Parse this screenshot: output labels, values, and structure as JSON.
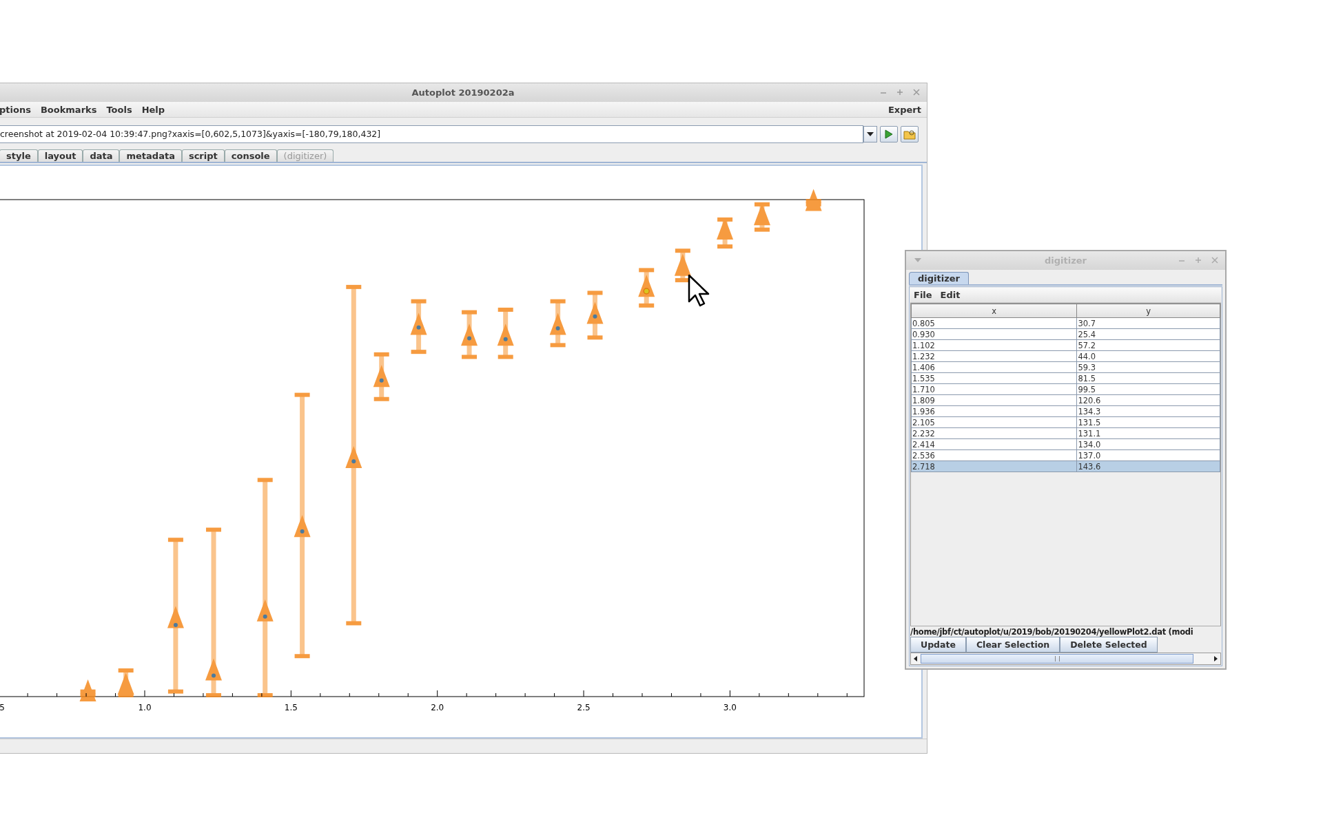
{
  "main_window": {
    "title": "Autoplot 20190202a",
    "menu": [
      "ptions",
      "Bookmarks",
      "Tools",
      "Help"
    ],
    "mode": "Expert",
    "url": "creenshot at 2019-02-04 10:39:47.png?xaxis=[0,602,5,1073]&yaxis=[-180,79,180,432]",
    "tabs": [
      {
        "label": "style",
        "selected": false,
        "disabled": false
      },
      {
        "label": "layout",
        "selected": false,
        "disabled": false
      },
      {
        "label": "data",
        "selected": false,
        "disabled": false
      },
      {
        "label": "metadata",
        "selected": false,
        "disabled": false
      },
      {
        "label": "script",
        "selected": false,
        "disabled": false
      },
      {
        "label": "console",
        "selected": false,
        "disabled": false
      },
      {
        "label": "(digitizer)",
        "selected": false,
        "disabled": true
      }
    ],
    "plot": {
      "xtick_labels": [
        "5",
        "1.0",
        "1.5",
        "2.0",
        "2.5",
        "3.0"
      ]
    }
  },
  "digitizer": {
    "title": "digitizer",
    "active": false,
    "tabs": [
      {
        "label": "digitizer",
        "selected": true
      }
    ],
    "menu": [
      "File",
      "Edit"
    ],
    "table": {
      "columns": [
        "x",
        "y"
      ],
      "rows": [
        {
          "cells": [
            "0.805",
            "30.7"
          ],
          "selected": false
        },
        {
          "cells": [
            "0.930",
            "25.4"
          ],
          "selected": false
        },
        {
          "cells": [
            "1.102",
            "57.2"
          ],
          "selected": false
        },
        {
          "cells": [
            "1.232",
            "44.0"
          ],
          "selected": false
        },
        {
          "cells": [
            "1.406",
            "59.3"
          ],
          "selected": false
        },
        {
          "cells": [
            "1.535",
            "81.5"
          ],
          "selected": false
        },
        {
          "cells": [
            "1.710",
            "99.5"
          ],
          "selected": false
        },
        {
          "cells": [
            "1.809",
            "120.6"
          ],
          "selected": false
        },
        {
          "cells": [
            "1.936",
            "134.3"
          ],
          "selected": false
        },
        {
          "cells": [
            "2.105",
            "131.5"
          ],
          "selected": false
        },
        {
          "cells": [
            "2.232",
            "131.1"
          ],
          "selected": false
        },
        {
          "cells": [
            "2.414",
            "134.0"
          ],
          "selected": false
        },
        {
          "cells": [
            "2.536",
            "137.0"
          ],
          "selected": false
        },
        {
          "cells": [
            "2.718",
            "143.6"
          ],
          "selected": true
        }
      ]
    },
    "file_path": "/home/jbf/ct/autoplot/u/2019/bob/20190204/yellowPlot2.dat (modi",
    "buttons": [
      "Update",
      "Clear Selection",
      "Delete Selected"
    ]
  }
}
